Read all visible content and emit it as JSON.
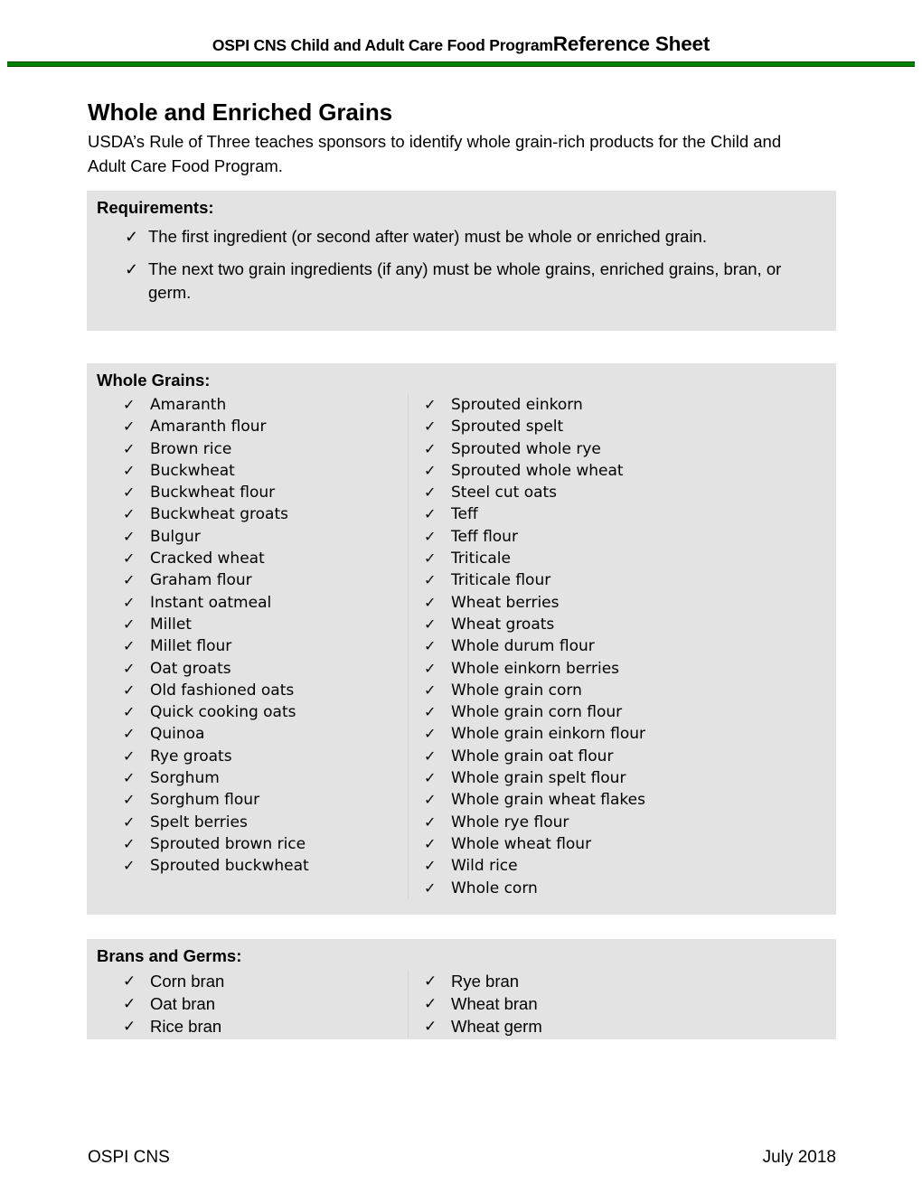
{
  "header": {
    "program": "OSPI CNS Child and Adult Care Food Program",
    "doc_type": "Reference Sheet",
    "rule_color": "#008000"
  },
  "title": {
    "heading": "Whole and Enriched Grains",
    "subtitle": "USDA’s Rule of Three teaches sponsors to identify whole grain-rich products for the Child and Adult Care Food Program."
  },
  "panel_color": "#e3e3e3",
  "check_glyph": "✓",
  "requirements": {
    "heading": "Requirements:",
    "items": [
      "The first ingredient (or second after water) must be whole or enriched grain.",
      "The next two grain ingredients (if any) must be whole grains, enriched grains, bran, or germ."
    ]
  },
  "whole_grains": {
    "heading": "Whole Grains:",
    "left_column": [
      "Amaranth",
      "Amaranth flour",
      "Brown rice",
      "Buckwheat",
      "Buckwheat flour",
      "Buckwheat groats",
      "Bulgur",
      "Cracked wheat",
      "Graham flour",
      "Instant oatmeal",
      "Millet",
      "Millet flour",
      "Oat groats",
      "Old fashioned oats",
      "Quick cooking oats",
      "Quinoa",
      "Rye groats",
      "Sorghum",
      "Sorghum flour",
      "Spelt berries",
      "Sprouted brown rice",
      "Sprouted buckwheat"
    ],
    "right_column": [
      "Sprouted einkorn",
      "Sprouted spelt",
      "Sprouted whole rye",
      "Sprouted whole wheat",
      "Steel cut oats",
      "Teff",
      "Teff flour",
      "Triticale",
      "Triticale flour",
      "Wheat berries",
      "Wheat groats",
      "Whole durum flour",
      "Whole einkorn berries",
      "Whole grain corn",
      "Whole grain corn flour",
      "Whole grain einkorn flour",
      "Whole grain oat flour",
      "Whole grain spelt flour",
      "Whole grain wheat flakes",
      "Whole rye flour",
      "Whole wheat flour",
      "Wild rice",
      "Whole corn"
    ]
  },
  "brans_and_germs": {
    "heading": "Brans and Germs:",
    "left_column": [
      "Corn bran",
      "Oat bran",
      "Rice bran"
    ],
    "right_column": [
      "Rye bran",
      "Wheat bran",
      "Wheat germ"
    ]
  },
  "footer": {
    "left": "OSPI CNS",
    "right": "July 2018"
  }
}
